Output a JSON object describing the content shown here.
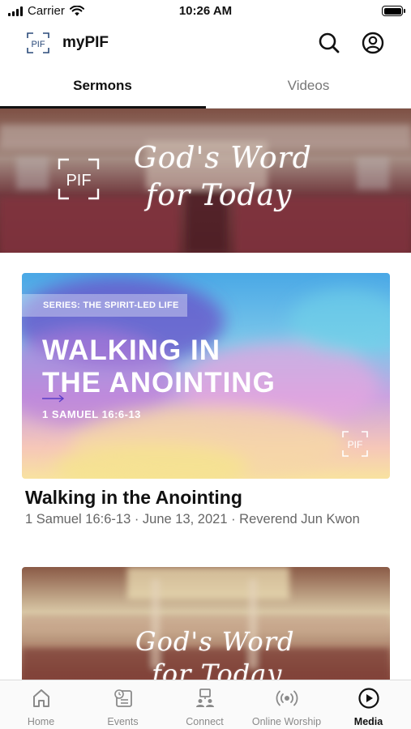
{
  "status_bar": {
    "carrier": "Carrier",
    "time": "10:26 AM"
  },
  "header": {
    "app_name": "myPIF",
    "logo_text": "PIF"
  },
  "tabs": [
    {
      "label": "Sermons",
      "active": true
    },
    {
      "label": "Videos",
      "active": false
    }
  ],
  "hero": {
    "logo_text": "PIF",
    "script_line1": "God's Word",
    "script_line2": "for Today"
  },
  "sermon_card": {
    "series_tag": "SERIES: THE SPIRIT-LED LIFE",
    "headline_line1": "WALKING IN",
    "headline_line2": "THE ANOINTING",
    "scripture": "1 SAMUEL 16:6-13",
    "logo_text": "PIF",
    "title": "Walking in the Anointing",
    "meta": "1 Samuel 16:6-13 · June 13, 2021 · Reverend Jun Kwon"
  },
  "second_card": {
    "script_line1": "God's Word",
    "script_line2": "for Today"
  },
  "tab_bar": [
    {
      "label": "Home",
      "icon": "home-icon",
      "active": false
    },
    {
      "label": "Events",
      "icon": "events-icon",
      "active": false
    },
    {
      "label": "Connect",
      "icon": "connect-icon",
      "active": false
    },
    {
      "label": "Online Worship",
      "icon": "broadcast-icon",
      "active": false
    },
    {
      "label": "Media",
      "icon": "play-icon",
      "active": true
    }
  ],
  "colors": {
    "accent": "#111111",
    "inactive": "#8a8a8a",
    "meta_text": "#666666"
  }
}
